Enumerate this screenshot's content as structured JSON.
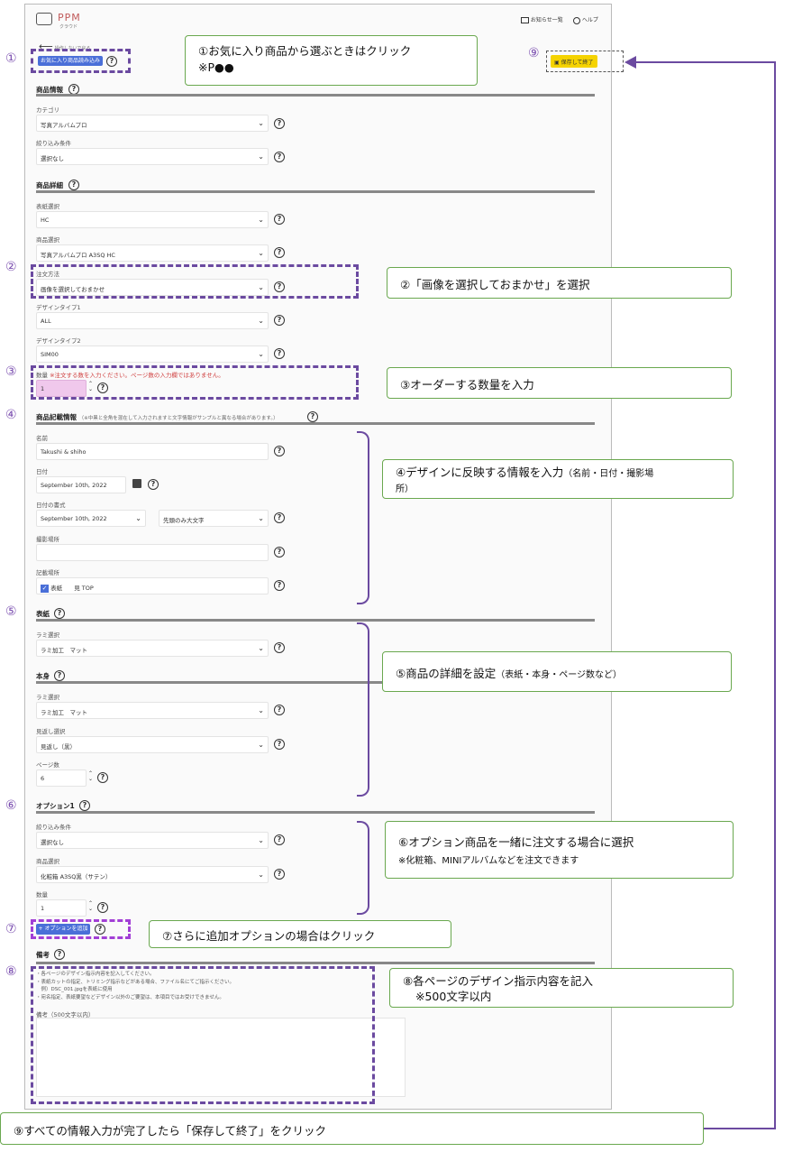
{
  "header": {
    "logo_text": "PPM",
    "logo_sub": "クラウド",
    "notices": "お知らせ一覧",
    "help": "ヘルプ",
    "back": "操作しないで戻る"
  },
  "toolbar": {
    "favorite_button": "お気に入り商品読み込み",
    "save_button": "保存して終了"
  },
  "sections": {
    "product_info": "商品情報",
    "product_detail": "商品詳細",
    "book_info": "商品記載情報",
    "book_info_note": "（※中黒と全角を混在して入力されますと文字情報がサンプルと異なる場合があります。）",
    "cover": "表紙",
    "body": "本身",
    "option1": "オプション1",
    "remarks": "備考"
  },
  "fields": {
    "category": {
      "label": "カテゴリ",
      "value": "写真アルバムプロ"
    },
    "filter": {
      "label": "絞り込み条件",
      "value": "選択なし"
    },
    "cover_select": {
      "label": "表紙選択",
      "value": "HC"
    },
    "product_select": {
      "label": "商品選択",
      "value": "写真アルバムプロ A3SQ HC"
    },
    "order_method": {
      "label": "注文方法",
      "value": "画像を選択しておまかせ"
    },
    "design_type1": {
      "label": "デザインタイプ1",
      "value": "ALL"
    },
    "design_type2": {
      "label": "デザインタイプ2",
      "value": "SIM00"
    },
    "quantity": {
      "label": "数量",
      "warning": "※注文する数を入力ください。ページ数の入力欄ではありません。",
      "value": "1"
    },
    "name": {
      "label": "名前",
      "value": "Takushi & shiho"
    },
    "date": {
      "label": "日付",
      "value": "September 10th, 2022"
    },
    "date_format": {
      "label": "日付の書式",
      "value": "September 10th, 2022",
      "case_value": "先頭のみ大文字"
    },
    "location": {
      "label": "撮影場所",
      "value": ""
    },
    "print_location": {
      "label": "記載場所",
      "opt1": "表紙",
      "opt2": "見 TOP"
    },
    "cover_lami": {
      "label": "ラミ選択",
      "value": "ラミ加工　マット"
    },
    "body_lami": {
      "label": "ラミ選択",
      "value": "ラミ加工　マット"
    },
    "endpaper": {
      "label": "見返し選択",
      "value": "見返し（黒）"
    },
    "pages": {
      "label": "ページ数",
      "value": "6"
    },
    "opt_filter": {
      "label": "絞り込み条件",
      "value": "選択なし"
    },
    "opt_product": {
      "label": "商品選択",
      "value": "化粧箱 A3SQ黒（サテン）"
    },
    "opt_qty": {
      "label": "数量",
      "value": "1"
    },
    "add_option": "+ オプションを追加",
    "remarks_notes": [
      "・各ページのデザイン指示内容を記入してください。",
      "・表紙カットの指定、トリミング指示などがある場合、ファイル名にてご指示ください。",
      "　例）DSC_001.jpgを表紙に使用",
      "・宛名指定、表紙要望などデザイン以外のご要望は、本項目ではお受けできません。"
    ],
    "remarks_label": "備考（500文字以内）"
  },
  "markers": [
    "①",
    "②",
    "③",
    "④",
    "⑤",
    "⑥",
    "⑦",
    "⑧",
    "⑨"
  ],
  "callouts": {
    "c1": "①お気に入り商品から選ぶときはクリック",
    "c1b": "※P●●",
    "c2": "②「画像を選択しておまかせ」を選択",
    "c3": "③オーダーする数量を入力",
    "c4": "④デザインに反映する情報を入力",
    "c4s": "（名前・日付・撮影場",
    "c4s2": "所）",
    "c5": "⑤商品の詳細を設定",
    "c5s": "（表紙・本身・ページ数など）",
    "c6": "⑥オプション商品を一緒に注文する場合に選択",
    "c6s": "※化粧箱、MINIアルバムなどを注文できます",
    "c7": "⑦さらに追加オプションの場合はクリック",
    "c8": "⑧各ページのデザイン指示内容を記入",
    "c8b": "※500文字以内",
    "c9": "⑨すべての情報入力が完了したら「保存して終了」をクリック"
  },
  "colors": {
    "accent": "#6b4aa0",
    "callout_border": "#6aa84f",
    "button_blue": "#4a6fd8",
    "save_yellow": "#f5d300",
    "qty_pink": "#f0c8ec"
  }
}
